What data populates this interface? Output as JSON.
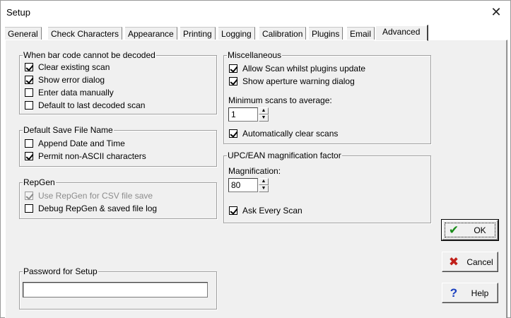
{
  "window": {
    "title": "Setup",
    "close_glyph": "✕"
  },
  "tabs": [
    {
      "label": "General",
      "active": false
    },
    {
      "label": "Check Characters",
      "active": false
    },
    {
      "label": "Appearance",
      "active": false
    },
    {
      "label": "Printing",
      "active": false
    },
    {
      "label": "Logging",
      "active": false
    },
    {
      "label": "Calibration",
      "active": false
    },
    {
      "label": "Plugins",
      "active": false
    },
    {
      "label": "Email",
      "active": false
    },
    {
      "label": "Advanced",
      "active": true
    }
  ],
  "decode_group": {
    "title": "When bar code cannot be decoded",
    "options": [
      {
        "label": "Clear existing scan",
        "checked": true
      },
      {
        "label": "Show error dialog",
        "checked": true
      },
      {
        "label": "Enter data manually",
        "checked": false
      },
      {
        "label": "Default to last decoded scan",
        "checked": false
      }
    ]
  },
  "save_group": {
    "title": "Default Save File Name",
    "options": [
      {
        "label": "Append Date and Time",
        "checked": false
      },
      {
        "label": "Permit non-ASCII characters",
        "checked": true
      }
    ]
  },
  "repgen_group": {
    "title": "RepGen",
    "options": [
      {
        "label": "Use RepGen for CSV file save",
        "checked": true,
        "disabled": true
      },
      {
        "label": "Debug RepGen & saved file log",
        "checked": false,
        "disabled": false
      }
    ]
  },
  "misc_group": {
    "title": "Miscellaneous",
    "allow_scan_label": "Allow Scan whilst plugins update",
    "allow_scan_checked": true,
    "aperture_label": "Show aperture warning dialog",
    "aperture_checked": true,
    "min_scans_label": "Minimum scans to average:",
    "min_scans_value": "1",
    "auto_clear_label": "Automatically clear scans",
    "auto_clear_checked": true
  },
  "upc_group": {
    "title": "UPC/EAN magnification factor",
    "magnification_label": "Magnification:",
    "magnification_value": "80",
    "ask_every_label": "Ask Every Scan",
    "ask_every_checked": true
  },
  "password_group": {
    "title": "Password for Setup",
    "value": ""
  },
  "buttons": {
    "ok_label": "OK",
    "cancel_label": "Cancel",
    "help_label": "Help"
  },
  "colors": {
    "panel": "#f0f0f0",
    "ok_icon": "#1a8c1a",
    "cancel_icon": "#c0201a",
    "help_icon": "#1a3fbf"
  },
  "icons": {
    "ok": "checkmark-icon",
    "cancel": "x-icon",
    "help": "question-icon"
  }
}
